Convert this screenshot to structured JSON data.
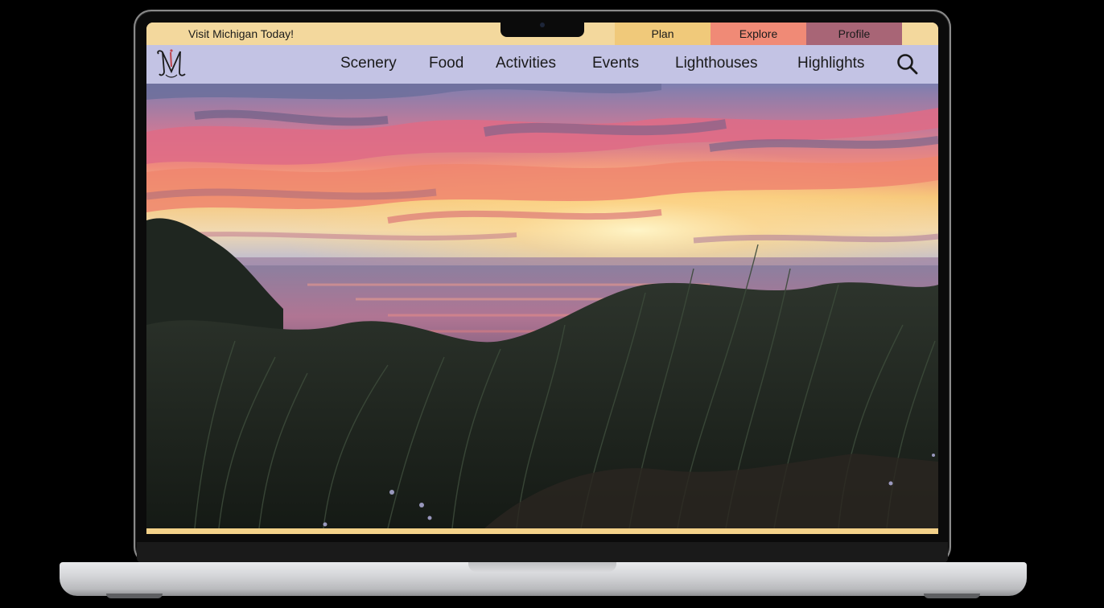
{
  "topbar": {
    "promo_text": "Visit Michigan Today!",
    "tabs": [
      {
        "label": "Plan",
        "color": "#f0c97a"
      },
      {
        "label": "Explore",
        "color": "#f08a76"
      },
      {
        "label": "Profile",
        "color": "#a86576"
      }
    ]
  },
  "nav": {
    "logo_letter": "M",
    "links": [
      {
        "label": "Scenery"
      },
      {
        "label": "Food"
      },
      {
        "label": "Activities"
      },
      {
        "label": "Events"
      },
      {
        "label": "Lighthouses"
      },
      {
        "label": "Highlights"
      }
    ],
    "search_icon": "search-icon",
    "background_color": "#c3c3e4"
  },
  "hero": {
    "image_subject": "sunset over lake with dune grass",
    "accent_strip_color": "#f3d189"
  },
  "device": {
    "type": "laptop",
    "frame_color": "#0b0b0b",
    "base_color": "#d5d6d9"
  }
}
